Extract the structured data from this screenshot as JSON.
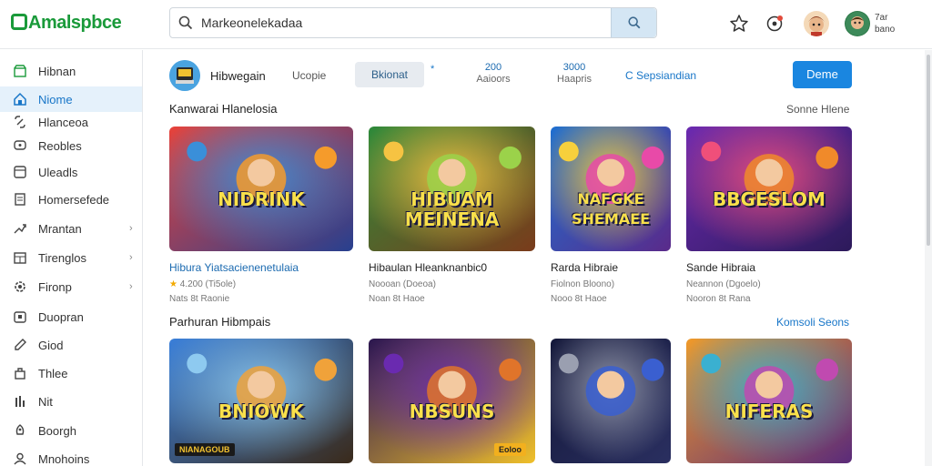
{
  "app": {
    "logo_text": "Amalspbce"
  },
  "search": {
    "value": "Markeonelekadaa"
  },
  "user": {
    "line1": "7ar",
    "line2": "bano"
  },
  "sidebar": {
    "items": [
      {
        "label": "Hibnan",
        "icon": "store-icon"
      },
      {
        "label": "Niome",
        "icon": "home-icon",
        "active": true
      },
      {
        "label": "Hlanceoa",
        "icon": "link-icon"
      },
      {
        "label": "Reobles",
        "icon": "chat-icon"
      },
      {
        "label": "Uleadls",
        "icon": "window-icon"
      },
      {
        "label": "Homersefede",
        "icon": "document-icon"
      },
      {
        "label": "Mrantan",
        "icon": "share-icon",
        "chevron": true
      },
      {
        "label": "Tirenglos",
        "icon": "calendar-icon",
        "chevron": true
      },
      {
        "label": "Fironp",
        "icon": "settings-icon",
        "chevron": true
      },
      {
        "label": "Duopran",
        "icon": "box-icon"
      },
      {
        "label": "Giod",
        "icon": "pencil-icon"
      },
      {
        "label": "Thlee",
        "icon": "bag-icon"
      },
      {
        "label": "Nit",
        "icon": "bars-icon"
      },
      {
        "label": "Boorgh",
        "icon": "rocket-icon"
      },
      {
        "label": "Mnohoins",
        "icon": "user-icon"
      }
    ]
  },
  "profile": {
    "name": "Hibwegain",
    "tab": "Ucopie",
    "chip": "Bkionat",
    "marker": "*",
    "stats": [
      {
        "value": "200",
        "label": "Aaioors"
      },
      {
        "value": "3000",
        "label": "Haapris"
      }
    ],
    "link": "C Sepsiandian",
    "button": "Deme"
  },
  "sections": [
    {
      "title": "Kanwarai Hlanelosia",
      "link": "Sonne Hlene",
      "cards": [
        {
          "art_text": "NIDRINK",
          "title": "Hibura Yiatsacienenetulaia",
          "meta1": "4.200 (Ti5ole)",
          "meta2": "Nats 8t Raonie",
          "rating": "★",
          "blue": true
        },
        {
          "art_text": "HIBUAM MEINENA",
          "title": "Hibaulan Hleanknanbic0",
          "meta1": "Noooan (Doeoa)",
          "meta2": "Noan 8t Haoe",
          "blue": false
        },
        {
          "art_text": "NAFGKE SHEMAEE",
          "title": "Rarda Hibraie",
          "meta1": "Fiolnon Bloono)",
          "meta2": "Nooo 8t Haoe",
          "blue": false
        },
        {
          "art_text": "BBGESLOM",
          "title": "Sande Hibraia",
          "meta1": "Neannon (Dgoelo)",
          "meta2": "Nooron 8t Rana",
          "blue": false
        }
      ]
    },
    {
      "title": "Parhuran Hibmpais",
      "link": "Komsoli Seons",
      "cards": [
        {
          "art_text": "BNIOWK",
          "badge": "NIANAGOUB"
        },
        {
          "art_text": "NBSUNS",
          "badge": "Eoloo"
        },
        {
          "art_text": ""
        },
        {
          "art_text": "NIFERAS"
        }
      ]
    }
  ],
  "colors": {
    "accent": "#1a86e0",
    "brand": "#1a9a3a",
    "active_bg": "#e5f1fb"
  }
}
